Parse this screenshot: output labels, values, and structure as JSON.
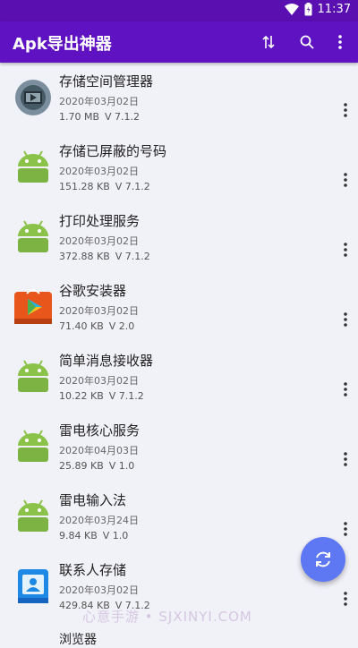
{
  "status_bar": {
    "time": "11:37"
  },
  "app_bar": {
    "title": "Apk导出神器"
  },
  "apps": [
    {
      "name": "存储空间管理器",
      "date": "2020年03月02日",
      "size": "1.70 MB",
      "version": "V 7.1.2",
      "icon": "storage-manager-icon"
    },
    {
      "name": "存储已屏蔽的号码",
      "date": "2020年03月02日",
      "size": "151.28 KB",
      "version": "V 7.1.2",
      "icon": "android-icon"
    },
    {
      "name": "打印处理服务",
      "date": "2020年03月02日",
      "size": "372.88 KB",
      "version": "V 7.1.2",
      "icon": "android-icon"
    },
    {
      "name": "谷歌安装器",
      "date": "2020年03月02日",
      "size": "71.40 KB",
      "version": "V 2.0",
      "icon": "google-installer-icon"
    },
    {
      "name": "简单消息接收器",
      "date": "2020年03月02日",
      "size": "10.22 KB",
      "version": "V 7.1.2",
      "icon": "android-icon"
    },
    {
      "name": "雷电核心服务",
      "date": "2020年04月03日",
      "size": "25.89 KB",
      "version": "V 1.0",
      "icon": "android-icon"
    },
    {
      "name": "雷电输入法",
      "date": "2020年03月24日",
      "size": "9.84 KB",
      "version": "V 1.0",
      "icon": "android-icon"
    },
    {
      "name": "联系人存储",
      "date": "2020年03月02日",
      "size": "429.84 KB",
      "version": "V 7.1.2",
      "icon": "contacts-storage-icon"
    }
  ],
  "partial_item": {
    "name": "浏览器"
  },
  "watermark": "心意手游 • SJXINYI.COM",
  "colors": {
    "app_bar": "#5e12c2",
    "status_bar": "#5a0fb0",
    "fab": "#5d78f2",
    "android_green": "#8bc34a"
  }
}
